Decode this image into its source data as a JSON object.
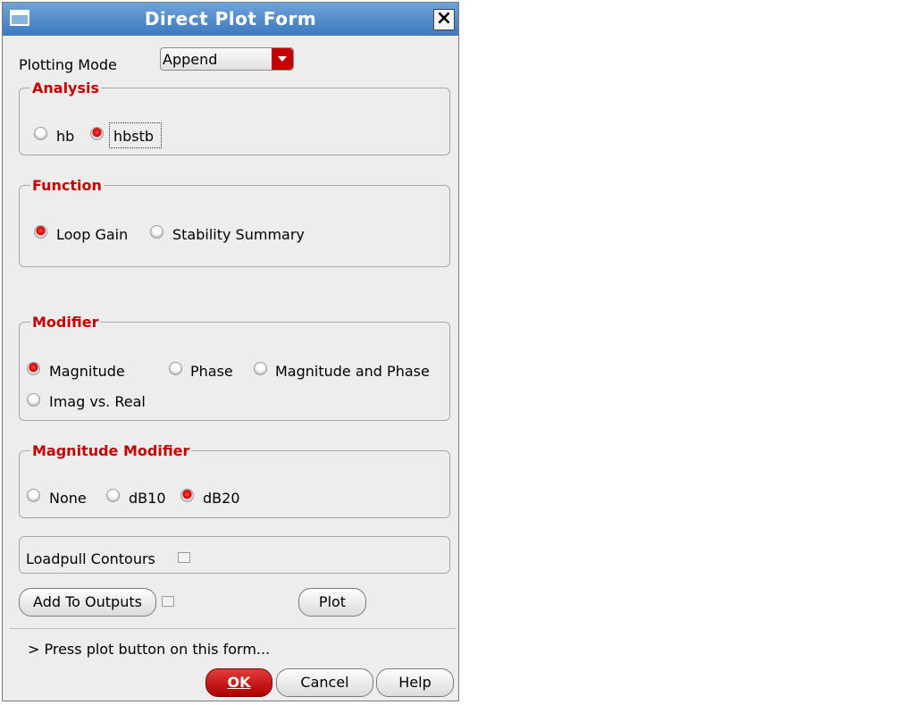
{
  "window": {
    "title": "Direct Plot Form"
  },
  "plotting_mode": {
    "label": "Plotting Mode",
    "value": "Append"
  },
  "analysis": {
    "legend": "Analysis",
    "options": [
      "hb",
      "hbstb"
    ],
    "selected": "hbstb"
  },
  "function": {
    "legend": "Function",
    "options": [
      "Loop Gain",
      "Stability Summary"
    ],
    "selected": "Loop Gain"
  },
  "modifier": {
    "legend": "Modifier",
    "options": [
      "Magnitude",
      "Phase",
      "Magnitude and Phase",
      "Imag vs. Real"
    ],
    "selected": "Magnitude"
  },
  "magnitude_modifier": {
    "legend": "Magnitude Modifier",
    "options": [
      "None",
      "dB10",
      "dB20"
    ],
    "selected": "dB20"
  },
  "loadpull": {
    "label": "Loadpull Contours",
    "checked": false
  },
  "buttons": {
    "add_to_outputs": "Add To Outputs",
    "plot": "Plot",
    "ok": "OK",
    "cancel": "Cancel",
    "help": "Help"
  },
  "status": "> Press plot button on this form...",
  "colors": {
    "accent": "#c40000",
    "title_bar": "#4a86c8"
  }
}
